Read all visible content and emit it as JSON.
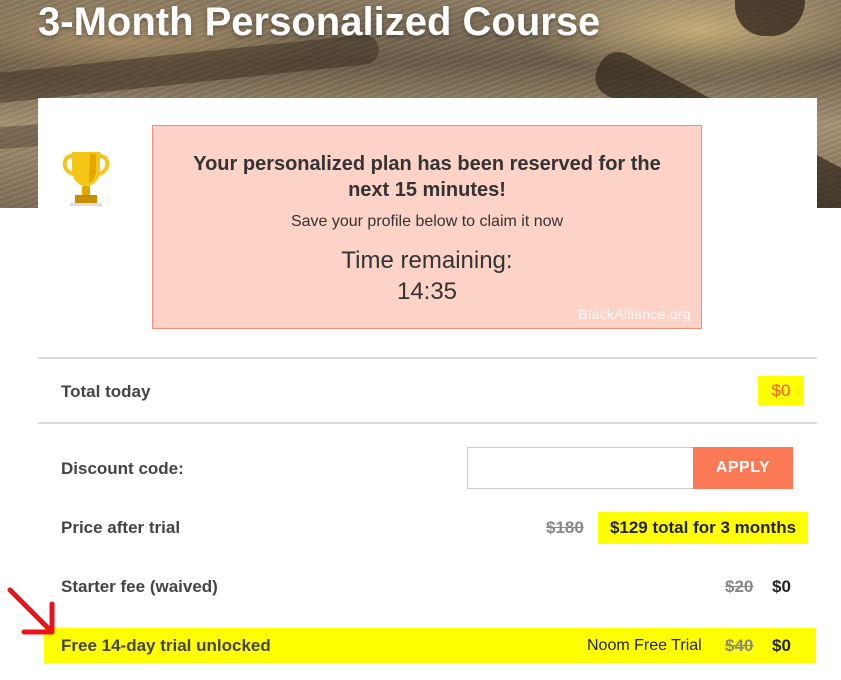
{
  "page": {
    "title": "3-Month Personalized Course"
  },
  "notice": {
    "headline": "Your personalized plan has been reserved for the next 15 minutes!",
    "subtext": "Save your profile below to claim it now",
    "timer_label": "Time remaining:",
    "timer_value": "14:35",
    "watermark": "BlackAlliance.org"
  },
  "summary": {
    "total_label": "Total today",
    "total_amount": "$0",
    "discount_label": "Discount code:",
    "discount_value": "",
    "discount_placeholder": "",
    "apply_label": "APPLY",
    "price_after_trial_label": "Price after trial",
    "price_after_trial_old": "$180",
    "price_after_trial_new": "$129 total for 3 months",
    "starter_fee_label": "Starter fee (waived)",
    "starter_fee_old": "$20",
    "starter_fee_new": "$0",
    "trial_label": "Free 14-day trial unlocked",
    "trial_tag": "Noom Free Trial",
    "trial_old": "$40",
    "trial_new": "$0"
  },
  "colors": {
    "accent": "#fb7955",
    "notice_bg": "#fdd2c7",
    "notice_border": "#ef8f76",
    "highlight": "#ffff00",
    "total_amount": "#f05a28",
    "annotation_arrow": "#e8141c",
    "trophy": "#f5c518"
  },
  "icons": {
    "trophy": "trophy-icon",
    "arrow": "red-arrow-annotation"
  }
}
